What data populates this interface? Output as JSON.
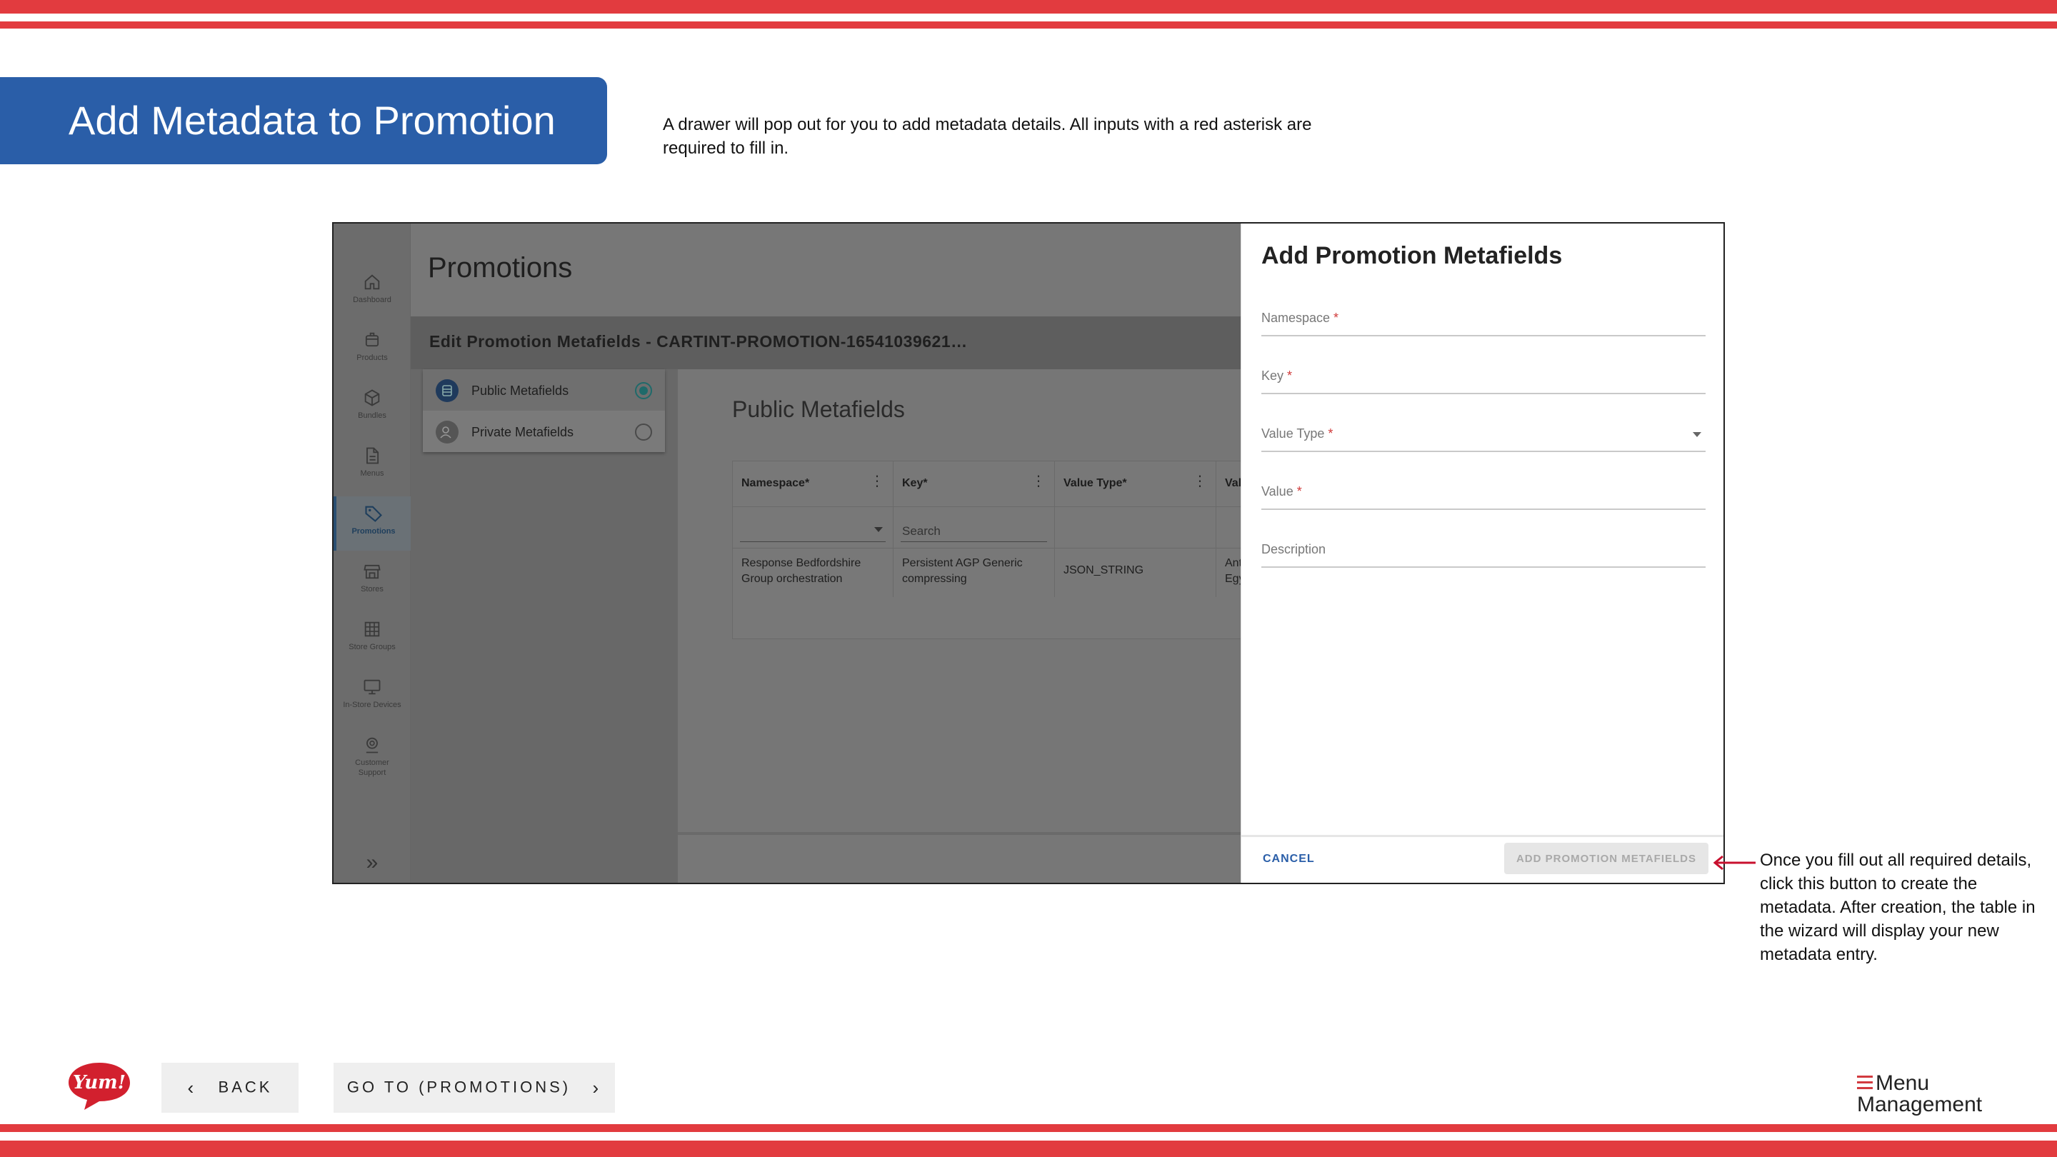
{
  "slide": {
    "title": "Add Metadata to Promotion",
    "intro": "A drawer will pop out for you to add metadata details. All inputs with a red asterisk are required to fill in.",
    "callout": "Once you fill out all required details, click this button to create the metadata. After creation, the table in the wizard will display your new metadata entry."
  },
  "app": {
    "page_title": "Promotions",
    "rail": [
      {
        "label": "Dashboard",
        "icon": "home-icon"
      },
      {
        "label": "Products",
        "icon": "box-icon"
      },
      {
        "label": "Bundles",
        "icon": "cube-icon"
      },
      {
        "label": "Menus",
        "icon": "document-icon"
      },
      {
        "label": "Promotions",
        "icon": "tag-icon",
        "active": true
      },
      {
        "label": "Stores",
        "icon": "store-icon"
      },
      {
        "label": "Store Groups",
        "icon": "grid-icon"
      },
      {
        "label": "In-Store Devices",
        "icon": "monitor-icon"
      },
      {
        "label": "Customer Support",
        "icon": "support-icon"
      }
    ],
    "edit_bar": "Edit Promotion Metafields - CARTINT-PROMOTION-16541039621…",
    "tabs": [
      {
        "label": "Public Metafields",
        "selected": true
      },
      {
        "label": "Private Metafields",
        "selected": false
      }
    ],
    "section_title": "Public Metafields",
    "grid": {
      "columns": [
        "Namespace*",
        "Key*",
        "Value Type*",
        "Val"
      ],
      "search_placeholder": "Search",
      "row": [
        "Response Bedfordshire Group orchestration",
        "Persistent AGP Generic compressing",
        "JSON_STRING",
        "Ant Egy"
      ]
    }
  },
  "drawer": {
    "title": "Add Promotion Metafields",
    "fields": [
      {
        "label": "Namespace",
        "required": "*"
      },
      {
        "label": "Key",
        "required": "*"
      },
      {
        "label": "Value Type",
        "required": "*"
      },
      {
        "label": "Value",
        "required": "*"
      },
      {
        "label": "Description",
        "required": ""
      }
    ],
    "cancel_label": "CANCEL",
    "add_label": "ADD PROMOTION METAFIELDS"
  },
  "footer": {
    "back_label": "BACK",
    "goto_label": "GO TO (PROMOTIONS)",
    "yum_logo_text": "Yum!",
    "brand_line1": "Menu",
    "brand_line2": "Management"
  },
  "colors": {
    "stripe": "#e23b3f",
    "banner": "#2a5ea8",
    "accent_teal": "#1f6a6a"
  }
}
